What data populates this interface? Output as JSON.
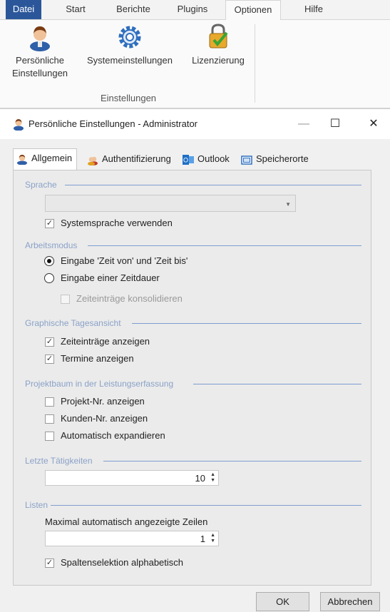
{
  "ribbon": {
    "tabs": [
      "Datei",
      "Start",
      "Berichte",
      "Plugins",
      "Optionen",
      "Hilfe"
    ],
    "active_tab": "Optionen",
    "buttons": [
      {
        "line1": "Persönliche",
        "line2": "Einstellungen",
        "icon": "user-icon"
      },
      {
        "line1": "Systemeinstellungen",
        "line2": "",
        "icon": "gear-icon"
      },
      {
        "line1": "Lizenzierung",
        "line2": "",
        "icon": "license-lock-icon"
      }
    ],
    "group_label": "Einstellungen"
  },
  "dialog": {
    "title": "Persönliche Einstellungen - Administrator",
    "controls": {
      "minimize": "—",
      "maximize": "☐",
      "close": "✕"
    },
    "tabs": [
      {
        "label": "Allgemein",
        "icon": "user-icon"
      },
      {
        "label": "Authentifizierung",
        "icon": "users-icon"
      },
      {
        "label": "Outlook",
        "icon": "outlook-icon"
      },
      {
        "label": "Speicherorte",
        "icon": "folder-icon"
      }
    ],
    "active_tab": "Allgemein",
    "sections": {
      "sprache": {
        "title": "Sprache",
        "combo_value": "",
        "system_language_label": "Systemsprache verwenden",
        "system_language_checked": true
      },
      "arbeitsmodus": {
        "title": "Arbeitsmodus",
        "option_von_bis": "Eingabe 'Zeit von' und 'Zeit bis'",
        "option_dauer": "Eingabe einer Zeitdauer",
        "selected": "option_von_bis",
        "consolidate_label": "Zeiteinträge konsolidieren",
        "consolidate_checked": false
      },
      "tagesansicht": {
        "title": "Graphische Tagesansicht",
        "show_entries_label": "Zeiteinträge anzeigen",
        "show_entries_checked": true,
        "show_appointments_label": "Termine anzeigen",
        "show_appointments_checked": true
      },
      "projektbaum": {
        "title": "Projektbaum in der Leistungserfassung",
        "project_nr_label": "Projekt-Nr. anzeigen",
        "project_nr_checked": false,
        "customer_nr_label": "Kunden-Nr. anzeigen",
        "customer_nr_checked": false,
        "auto_expand_label": "Automatisch expandieren",
        "auto_expand_checked": false
      },
      "letzte": {
        "title": "Letzte Tätigkeiten",
        "value": "10"
      },
      "listen": {
        "title": "Listen",
        "max_rows_label": "Maximal automatisch angezeigte Zeilen",
        "max_rows_value": "1",
        "alpha_label": "Spaltenselektion alphabetisch",
        "alpha_checked": true
      }
    },
    "ok_label": "OK",
    "cancel_label": "Abbrechen",
    "colors": {
      "section_title": "#8aa2c8",
      "section_line": "#7f9dd1",
      "file_tab": "#2b579a"
    }
  }
}
